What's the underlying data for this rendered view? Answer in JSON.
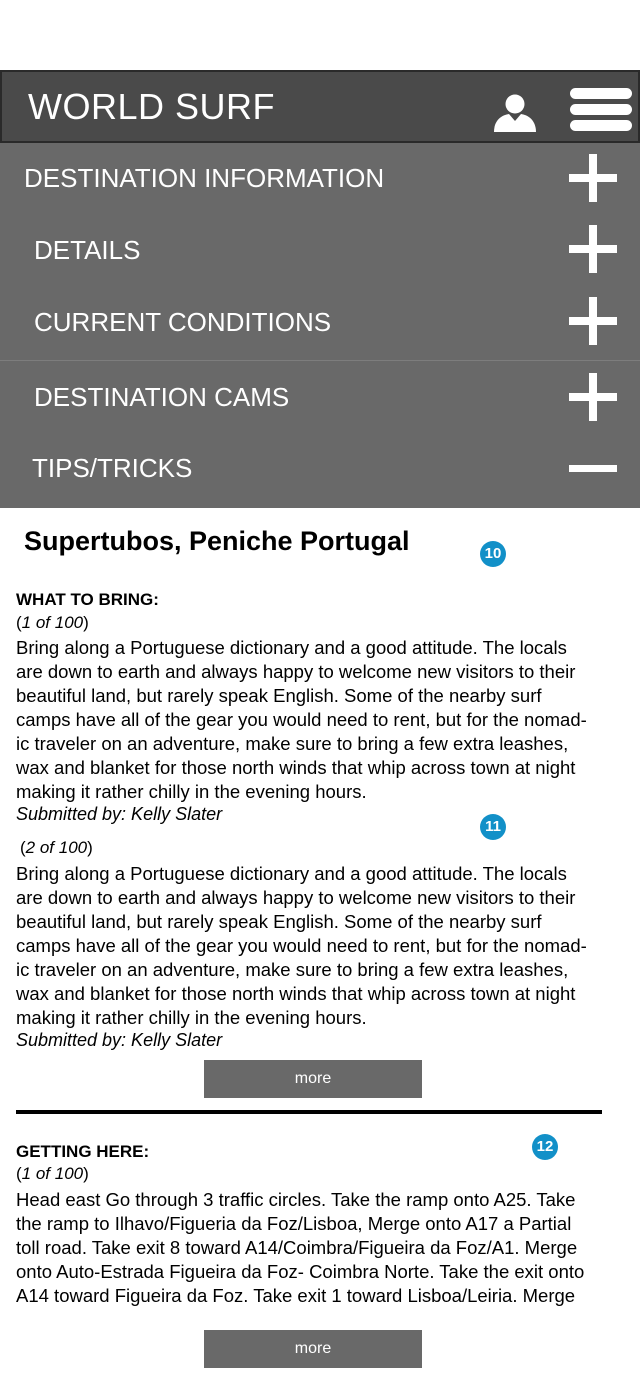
{
  "header": {
    "title": "WORLD SURF",
    "user_icon": "user-icon",
    "menu_icon": "hamburger-menu-icon"
  },
  "menu": {
    "items": [
      {
        "label": "DESTINATION INFORMATION",
        "state": "plus"
      },
      {
        "label": "DETAILS",
        "state": "plus"
      },
      {
        "label": "CURRENT CONDITIONS",
        "state": "plus"
      },
      {
        "label": "DESTINATION CAMS",
        "state": "plus"
      },
      {
        "label": "TIPS/TRICKS",
        "state": "minus"
      }
    ]
  },
  "page": {
    "title": "Supertubos, Peniche Portugal"
  },
  "badges": [
    "10",
    "11",
    "12"
  ],
  "what_to_bring": {
    "heading": "WHAT TO BRING:",
    "entries": [
      {
        "count": "1 of 100",
        "lines": [
          "Bring along a Portuguese dictionary and a good attitude. The locals",
          "are down to earth and always happy to welcome new visitors to their",
          "beautiful land, but rarely speak English. Some of the nearby surf",
          "camps have all of the gear you would need to rent, but for the nomad-",
          "ic traveler on an adventure, make sure to bring a few extra leashes,",
          "wax and blanket for those north winds that whip across town at night",
          "making it rather chilly in the evening hours."
        ],
        "submitted": "Submitted by: Kelly Slater"
      },
      {
        "count": "2 of 100",
        "lines": [
          "Bring along a Portuguese dictionary and a good attitude. The locals",
          "are down to earth and always happy to welcome new visitors to their",
          "beautiful land, but rarely speak English. Some of the nearby surf",
          "camps have all of the gear you would need to rent, but for the nomad-",
          "ic traveler on an adventure, make sure to bring a few extra leashes,",
          "wax and blanket for those north winds that whip across town at night",
          "making it rather chilly in the evening hours."
        ],
        "submitted": "Submitted by: Kelly Slater"
      }
    ],
    "more_label": "more"
  },
  "getting_here": {
    "heading": "GETTING HERE:",
    "count": "1 of 100",
    "lines": [
      "Head east Go through 3 traffic circles. Take the ramp onto A25. Take",
      "the ramp to Ilhavo/Figueria da Foz/Lisboa, Merge onto A17 a Partial",
      "toll road. Take exit 8 toward A14/Coimbra/Figueira da Foz/A1. Merge",
      "onto Auto-Estrada Figueira da Foz- Coimbra Norte. Take the exit onto",
      "A14 toward Figueira da Foz. Take exit 1 toward Lisboa/Leiria. Merge"
    ],
    "more_label": "more"
  },
  "colors": {
    "header_bg": "#4a4a4a",
    "menu_bg": "#696969",
    "badge": "#1290c8",
    "button_bg": "#696969"
  }
}
